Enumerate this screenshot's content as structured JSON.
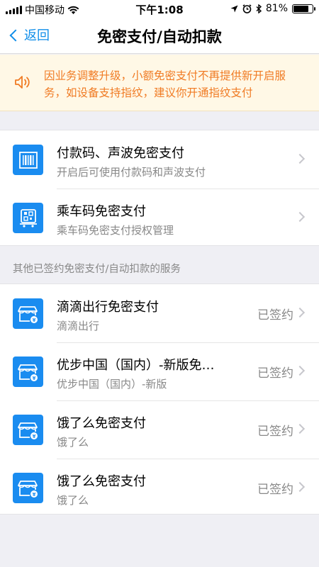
{
  "status_bar": {
    "carrier": "中国移动",
    "time": "下午1:08",
    "battery": "81%",
    "battery_level": 0.81
  },
  "nav": {
    "back_label": "返回",
    "title": "免密支付/自动扣款"
  },
  "notice": {
    "text": "因业务调整升级，小额免密支付不再提供新开启服务，如设备支持指纹，建议你开通指纹支付"
  },
  "main_items": [
    {
      "icon": "barcode-icon",
      "title": "付款码、声波免密支付",
      "subtitle": "开启后可使用付款码和声波支付"
    },
    {
      "icon": "transit-qr-icon",
      "title": "乘车码免密支付",
      "subtitle": "乘车码免密支付授权管理"
    }
  ],
  "section_header": "其他已签约免密支付/自动扣款的服务",
  "signed_services": [
    {
      "icon": "shop-icon",
      "title": "滴滴出行免密支付",
      "subtitle": "滴滴出行",
      "status": "已签约"
    },
    {
      "icon": "shop-icon",
      "title": "优步中国（国内）-新版免…",
      "subtitle": "优步中国（国内）-新版",
      "status": "已签约"
    },
    {
      "icon": "shop-icon",
      "title": "饿了么免密支付",
      "subtitle": "饿了么",
      "status": "已签约"
    },
    {
      "icon": "shop-icon",
      "title": "饿了么免密支付",
      "subtitle": "饿了么",
      "status": "已签约"
    }
  ],
  "colors": {
    "accent": "#108ee9",
    "notice_text": "#f07b24",
    "notice_bg": "#fff8e6",
    "icon_bg": "#1a8cf0"
  }
}
